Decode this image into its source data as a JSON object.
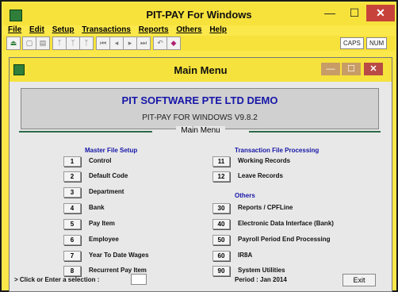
{
  "app": {
    "title": "PIT-PAY For Windows",
    "minimize_glyph": "—",
    "maximize_glyph": "☐",
    "close_glyph": "✕"
  },
  "menubar": [
    "File",
    "Edit",
    "Setup",
    "Transactions",
    "Reports",
    "Others",
    "Help"
  ],
  "toolbar": {
    "icons": [
      "exit-icon",
      "print-preview-icon",
      "print-icon",
      "filter-icon",
      "filter-select-icon",
      "filter-clear-icon",
      "first-record-icon",
      "prev-record-icon",
      "next-record-icon",
      "last-record-icon",
      "undo-icon",
      "eraser-icon"
    ],
    "caps": "CAPS",
    "num": "NUM"
  },
  "child_window": {
    "title": "Main Menu"
  },
  "banner": {
    "company": "PIT SOFTWARE PTE LTD DEMO",
    "version": "PIT-PAY FOR WINDOWS V9.8.2"
  },
  "section_title": "Main Menu",
  "left_column": {
    "heading": "Master File Setup",
    "items": [
      {
        "num": "1",
        "label": "Control"
      },
      {
        "num": "2",
        "label": "Default Code"
      },
      {
        "num": "3",
        "label": "Department"
      },
      {
        "num": "4",
        "label": "Bank"
      },
      {
        "num": "5",
        "label": "Pay Item"
      },
      {
        "num": "6",
        "label": "Employee"
      },
      {
        "num": "7",
        "label": "Year To Date Wages"
      },
      {
        "num": "8",
        "label": "Recurrent Pay Item"
      }
    ]
  },
  "right_column": {
    "heading": "Transaction File Processing",
    "items": [
      {
        "num": "11",
        "label": "Working Records"
      },
      {
        "num": "12",
        "label": "Leave Records"
      }
    ],
    "heading2": "Others",
    "items2": [
      {
        "num": "30",
        "label": "Reports / CPFLine"
      },
      {
        "num": "40",
        "label": "Electronic Data Interface (Bank)"
      },
      {
        "num": "50",
        "label": "Payroll Period End Processing"
      },
      {
        "num": "60",
        "label": "IR8A"
      },
      {
        "num": "90",
        "label": "System Utilities"
      }
    ]
  },
  "footer": {
    "prompt": "> Click or Enter a selection :",
    "selection_value": "",
    "period": "Period : Jan 2014",
    "exit_label": "Exit"
  }
}
